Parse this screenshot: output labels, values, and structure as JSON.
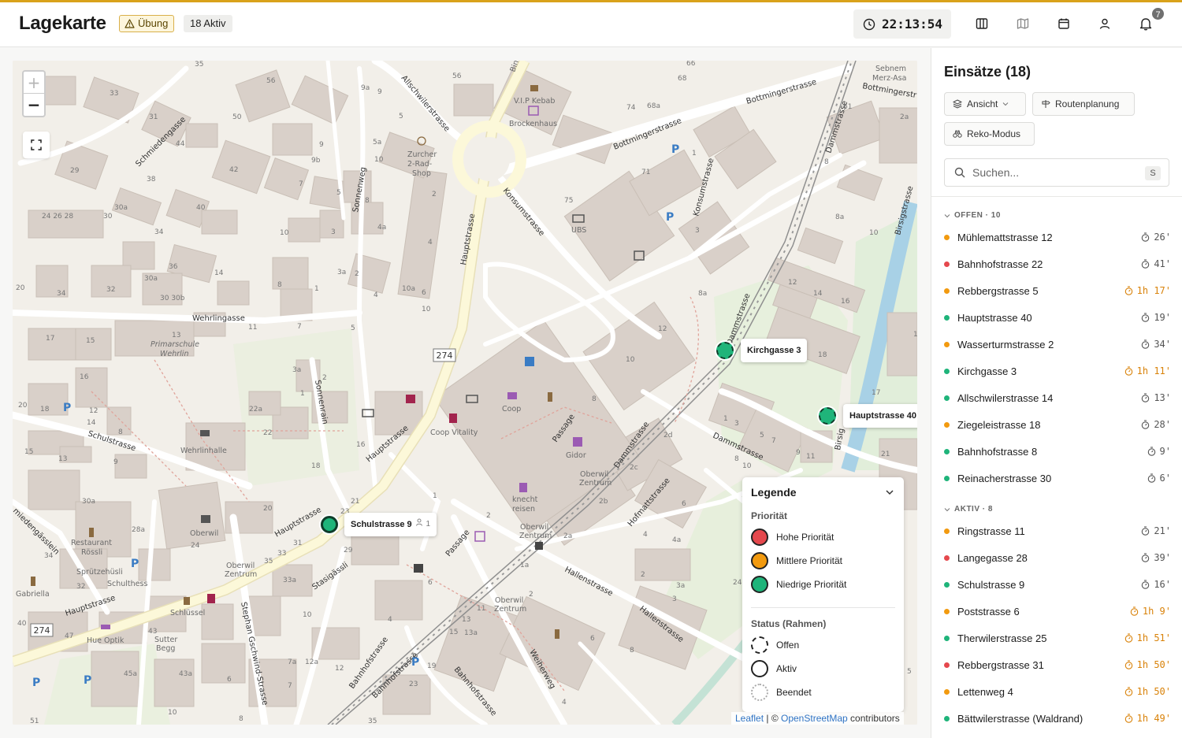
{
  "header": {
    "title": "Lagekarte",
    "badge_exercise": "Übung",
    "badge_active": "18 Aktiv",
    "clock": "22:13:54",
    "notifications_count": "7",
    "accent": "#d9a21b"
  },
  "map": {
    "streets": {
      "hauptstrasse_a": "Hauptstrasse",
      "hauptstrasse_b": "Hauptstrasse",
      "hauptstrasse_c": "Hauptstrasse",
      "hauptstrasse_d": "Hauptstrasse",
      "route_number": "274",
      "route_number_2": "274",
      "bottmingerstrasse_a": "Bottmingerstrasse",
      "bottmingerstrasse_b": "Bottmingerstrasse",
      "bottmingerstrasse_c": "Bottmingerstr",
      "allschwilerstrasse": "Allschwilerstrasse",
      "konsumstrasse_a": "Konsumstrasse",
      "konsumstrasse_b": "Konsumstrasse",
      "dammstrasse_a": "Dammstrasse",
      "dammstrasse_b": "Dammstrasse",
      "dammstrasse_c": "Dammstrasse",
      "dammstrasse_d": "Dammstrasse",
      "birsigstrasse": "Birsigstrasse",
      "schmiedengasse": "Schmiedengasse",
      "sonnenweg": "Sonnenweg",
      "sonnenrain": "Sonnenrain",
      "wehrlingasse": "Wehrlingasse",
      "schulstrasse_a": "Schulstrasse",
      "schulstrasse_b": "Schulstrasse",
      "hofmattstrasse": "Hofmattstrasse",
      "hallenstrasse_a": "Hallenstrasse",
      "hallenstrasse_b": "Hallenstrasse",
      "weiherweg": "Weiherweg",
      "bahnhofstrasse_a": "Bahnhofstrasse",
      "bahnhofstrasse_b": "Bahnhofstrasse",
      "bahnhofstrasse_c": "Bahnhofstrasse",
      "stephan_gschwind": "Stephan Gschwind-Strasse",
      "stasigassli": "Stasigässli",
      "passage_a": "Passage",
      "passage_b": "Passage",
      "schmiedengaesslein": "miedengässlein",
      "birsig": "Birsig"
    },
    "pois": {
      "vip_kebab": "V.I.P Kebab",
      "brockenhaus": "Brockenhaus",
      "zurcher": "Zurcher",
      "zurcher2": "2-Rad-",
      "zurcher3": "Shop",
      "ubs": "UBS",
      "coop": "Coop",
      "coop_vitality": "Coop Vitality",
      "gidor": "Gidor",
      "knecht1": "knecht",
      "knecht2": "reisen",
      "oberwil_zentrum1": "Oberwil",
      "oberwil_zentrum2": "Zentrum",
      "primarschule1": "Primarschule",
      "primarschule2": "Wehrlin",
      "wehrlinhalle": "Wehrlinhalle",
      "restaurant1": "Restaurant",
      "restaurant2": "Rössli",
      "oberwil": "Oberwil",
      "spruetzehuesli": "Sprützehüsli",
      "schulthess": "Schulthess",
      "gabriella": "Gabriella",
      "schlussel": "Schlüssel",
      "hue_optik": "Hue Optik",
      "sutter1": "Sutter",
      "sutter2": "Begg",
      "sebnem1": "Sebnem",
      "sebnem2": "Merz-Asa",
      "bin": "Bin"
    },
    "markers": {
      "kirchgasse": "Kirchgasse 3",
      "hauptstrasse": "Hauptstrasse 40",
      "schulstrasse": "Schulstrasse 9",
      "schulstrasse_count": "1"
    },
    "attribution": {
      "leaflet": "Leaflet",
      "sep": " | © ",
      "osm": "OpenStreetMap",
      "contributors": " contributors"
    }
  },
  "legend": {
    "title": "Legende",
    "priority_title": "Priorität",
    "priorities": [
      {
        "label": "Hohe Priorität",
        "color": "#e5484d"
      },
      {
        "label": "Mittlere Priorität",
        "color": "#f29a0f"
      },
      {
        "label": "Niedrige Priorität",
        "color": "#1fb47a"
      }
    ],
    "status_title": "Status (Rahmen)",
    "status": [
      {
        "label": "Offen"
      },
      {
        "label": "Aktiv"
      },
      {
        "label": "Beendet"
      }
    ]
  },
  "panel": {
    "title": "Einsätze (18)",
    "btn_ansicht": "Ansicht",
    "btn_routen": "Routenplanung",
    "btn_reko": "Reko-Modus",
    "search_placeholder": "Suchen...",
    "search_shortcut": "S",
    "group_open": "OFFEN · 10",
    "group_active": "AKTIV · 8",
    "open_items": [
      {
        "name": "Mühlemattstrasse 12",
        "time": "26'",
        "color": "#f29a0f",
        "late": false
      },
      {
        "name": "Bahnhofstrasse 22",
        "time": "41'",
        "color": "#e5484d",
        "late": false
      },
      {
        "name": "Rebbergstrasse 5",
        "time": "1h 17'",
        "color": "#f29a0f",
        "late": true
      },
      {
        "name": "Hauptstrasse 40",
        "time": "19'",
        "color": "#1fb47a",
        "late": false
      },
      {
        "name": "Wasserturmstrasse 2",
        "time": "34'",
        "color": "#f29a0f",
        "late": false
      },
      {
        "name": "Kirchgasse 3",
        "time": "1h 11'",
        "color": "#1fb47a",
        "late": true
      },
      {
        "name": "Allschwilerstrasse 14",
        "time": "13'",
        "color": "#1fb47a",
        "late": false
      },
      {
        "name": "Ziegeleistrasse 18",
        "time": "28'",
        "color": "#f29a0f",
        "late": false
      },
      {
        "name": "Bahnhofstrasse 8",
        "time": "9'",
        "color": "#1fb47a",
        "late": false
      },
      {
        "name": "Reinacherstrasse 30",
        "time": "6'",
        "color": "#1fb47a",
        "late": false
      }
    ],
    "active_items": [
      {
        "name": "Ringstrasse 11",
        "time": "21'",
        "color": "#f29a0f",
        "late": false
      },
      {
        "name": "Langegasse 28",
        "time": "39'",
        "color": "#e5484d",
        "late": false
      },
      {
        "name": "Schulstrasse 9",
        "time": "16'",
        "color": "#1fb47a",
        "late": false
      },
      {
        "name": "Poststrasse 6",
        "time": "1h 9'",
        "color": "#f29a0f",
        "late": true
      },
      {
        "name": "Therwilerstrasse 25",
        "time": "1h 51'",
        "color": "#1fb47a",
        "late": true
      },
      {
        "name": "Rebbergstrasse 31",
        "time": "1h 50'",
        "color": "#e5484d",
        "late": true
      },
      {
        "name": "Lettenweg 4",
        "time": "1h 50'",
        "color": "#f29a0f",
        "late": true
      },
      {
        "name": "Bättwilerstrasse (Waldrand)",
        "time": "1h 49'",
        "color": "#1fb47a",
        "late": true
      }
    ]
  }
}
